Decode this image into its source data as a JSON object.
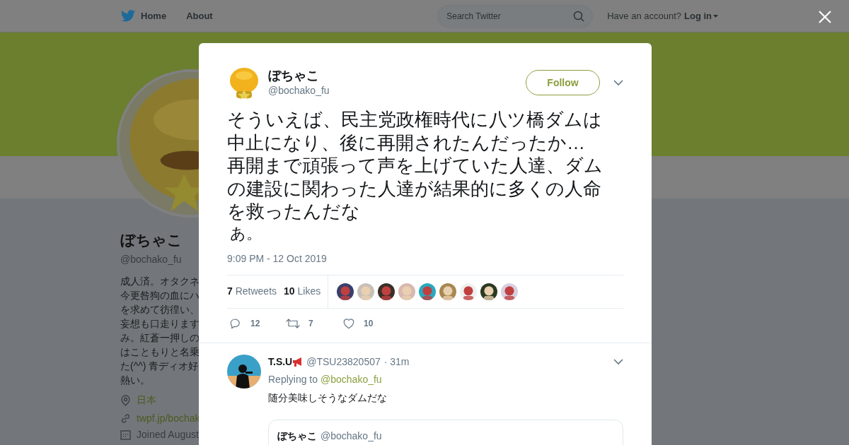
{
  "top_nav": {
    "items": [
      {
        "label": "Home",
        "kind": "logo"
      },
      {
        "label": "About",
        "kind": "plain"
      }
    ],
    "search": {
      "placeholder": "Search Twitter"
    },
    "account_prompt": "Have an account?",
    "login": "Log in"
  },
  "profile": {
    "name": "ぼちゃこ",
    "handle": "@bochako_fu",
    "bio_lines": [
      "成人済。オタクネ",
      "今更咎狗の血にハ",
      "を求めて彷徨い、",
      "妄想も口走ります",
      "み。紅蒼一押しの",
      "はこともりと名乗",
      "た(^^) 青ディオ好",
      "熱い。"
    ],
    "location": "日本",
    "website": "twpf.jp/bochak",
    "joined": "Joined August"
  },
  "tweet": {
    "name": "ぼちゃこ",
    "handle": "@bochako_fu",
    "follow": "Follow",
    "text_lines": [
      "そういえば、民主党政権時代に八ツ橋ダムは",
      "中止になり、後に再開されたんだったか…",
      "再開まで頑張って声を上げていた人達、ダム",
      "の建設に関わった人達が結果的に多くの人命",
      "を救ったんだな"
    ],
    "text_tail": "あ。",
    "time": "9:09 PM - 12 Oct 2019",
    "retweets": {
      "count": "7",
      "label": "Retweets"
    },
    "likes": {
      "count": "10",
      "label": "Likes"
    },
    "actions": [
      {
        "kind": "reply",
        "count": "12"
      },
      {
        "kind": "retweet",
        "count": "7"
      },
      {
        "kind": "like",
        "count": "10"
      }
    ]
  },
  "reply": {
    "name": "T.S.U",
    "handle": "@TSU23820507",
    "age": "· 31m",
    "replying_label": "Replying to",
    "replying_to": "@bochako_fu",
    "text": "随分美味しそうなダムだな",
    "quote": {
      "name": "ぼちゃこ",
      "handle": "@bochako_fu"
    }
  }
}
